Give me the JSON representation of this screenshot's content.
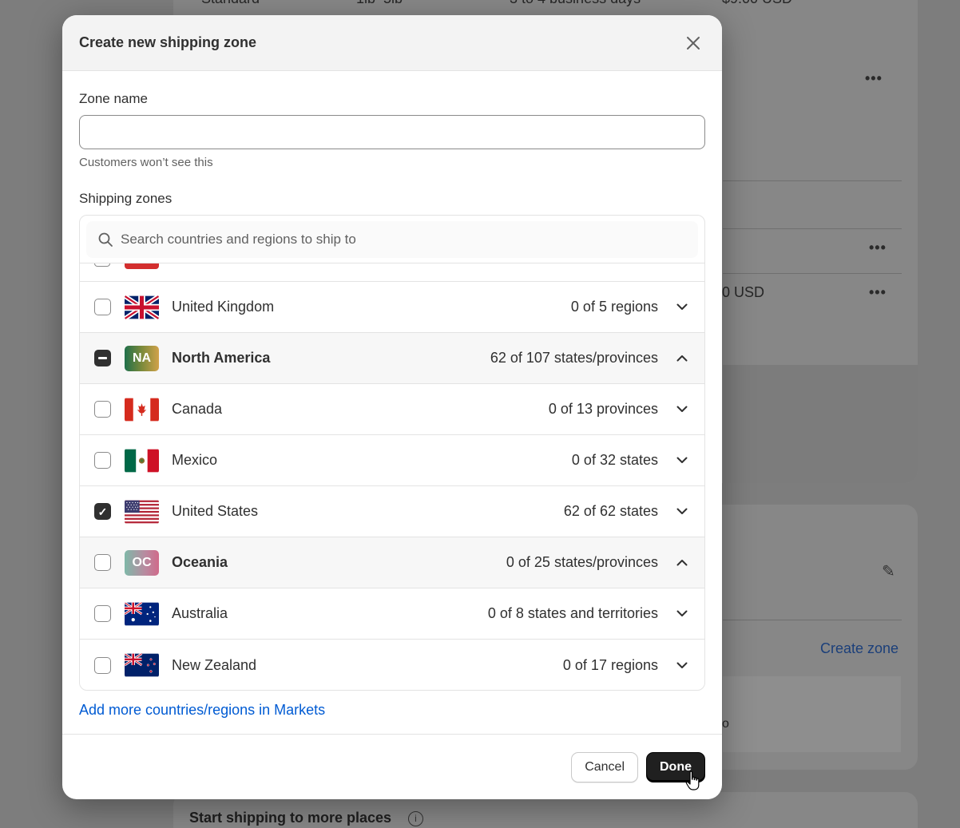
{
  "background": {
    "top_row_fragments": [
      "Standard",
      "1lb–5lb",
      "3 to 4 business days",
      "$9.00 USD"
    ],
    "price_fragment": "0 USD",
    "create_zone_link": "Create zone",
    "bottom_card_title": "Start shipping to more places",
    "fragment_o": "o"
  },
  "modal": {
    "title": "Create new shipping zone",
    "zone_name_label": "Zone name",
    "zone_name_value": "",
    "zone_name_help": "Customers won’t see this",
    "shipping_zones_label": "Shipping zones",
    "search_placeholder": "Search countries and regions to ship to",
    "rows": [
      {
        "name": "United Kingdom",
        "count": "0 of 5 regions",
        "type": "country",
        "flag": "uk",
        "state": "unchecked",
        "chevron": "down"
      },
      {
        "name": "North America",
        "count": "62 of 107 states/provinces",
        "type": "region",
        "badge": "NA",
        "state": "indeterminate",
        "chevron": "up"
      },
      {
        "name": "Canada",
        "count": "0 of 13 provinces",
        "type": "country",
        "flag": "ca",
        "state": "unchecked",
        "chevron": "down"
      },
      {
        "name": "Mexico",
        "count": "0 of 32 states",
        "type": "country",
        "flag": "mx",
        "state": "unchecked",
        "chevron": "down"
      },
      {
        "name": "United States",
        "count": "62 of 62 states",
        "type": "country",
        "flag": "us",
        "state": "checked",
        "chevron": "down"
      },
      {
        "name": "Oceania",
        "count": "0 of 25 states/provinces",
        "type": "region",
        "badge": "OC",
        "state": "unchecked",
        "chevron": "up"
      },
      {
        "name": "Australia",
        "count": "0 of 8 states and territories",
        "type": "country",
        "flag": "au",
        "state": "unchecked",
        "chevron": "down"
      },
      {
        "name": "New Zealand",
        "count": "0 of 17 regions",
        "type": "country",
        "flag": "nz",
        "state": "unchecked",
        "chevron": "down"
      }
    ],
    "add_more_link": "Add more countries/regions in Markets",
    "cancel_label": "Cancel",
    "done_label": "Done"
  },
  "colors": {
    "link": "#005bd3",
    "primary_button": "#202020",
    "overlay": "#7d7d7d"
  }
}
